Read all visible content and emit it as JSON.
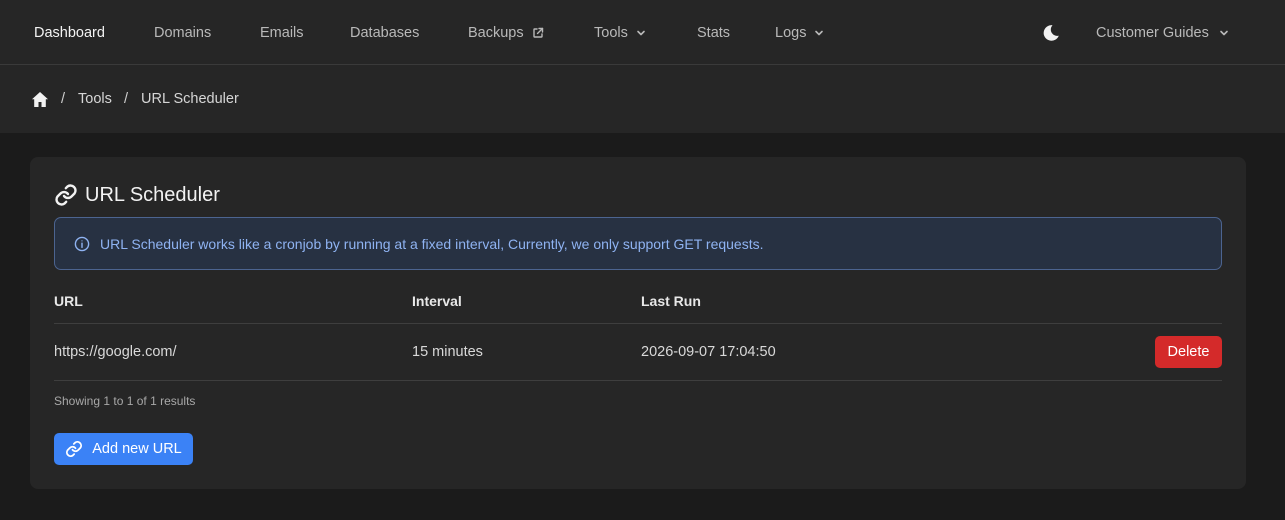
{
  "nav": {
    "items": [
      {
        "label": "Dashboard",
        "active": true
      },
      {
        "label": "Domains"
      },
      {
        "label": "Emails"
      },
      {
        "label": "Databases"
      },
      {
        "label": "Backups",
        "icon": "external-link-icon"
      },
      {
        "label": "Tools",
        "icon": "chevron-down-icon"
      },
      {
        "label": "Stats"
      },
      {
        "label": "Logs",
        "icon": "chevron-down-icon"
      }
    ],
    "theme_icon": "moon-icon",
    "guides_label": "Customer Guides"
  },
  "breadcrumb": {
    "home_icon": "home-icon",
    "separator": "/",
    "items": [
      "Tools",
      "URL Scheduler"
    ]
  },
  "card": {
    "title": "URL Scheduler",
    "title_icon": "link-icon",
    "alert_icon": "info-icon",
    "alert_text": "URL Scheduler works like a cronjob by running at a fixed interval, Currently, we only support GET requests."
  },
  "table": {
    "columns": [
      "URL",
      "Interval",
      "Last Run"
    ],
    "rows": [
      {
        "url": "https://google.com/",
        "interval": "15 minutes",
        "last_run": "2026-09-07 17:04:50",
        "action": "Delete"
      }
    ],
    "showing": "Showing 1 to 1 of 1 results"
  },
  "add_button": "Add new URL",
  "colors": {
    "accent": "#3b82f6",
    "danger": "#d42a2a",
    "alert_text": "#8fb3f2",
    "background": "#1b1b1b",
    "surface": "#262626"
  }
}
